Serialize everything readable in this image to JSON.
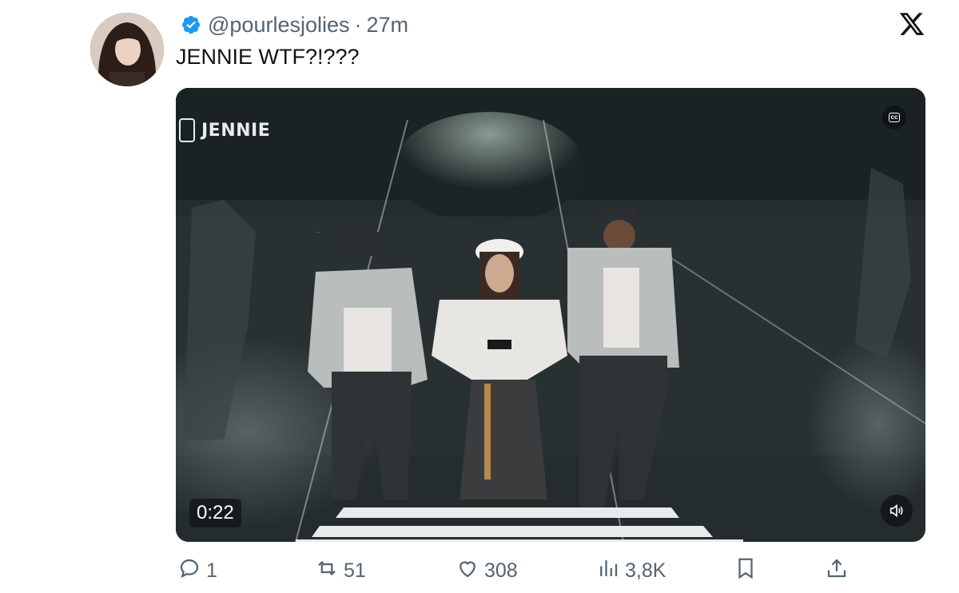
{
  "tweet": {
    "handle": "@pourlesjolies",
    "separator": "·",
    "time": "27m",
    "text": "JENNIE WTF?!???"
  },
  "video": {
    "channel_label": "JENNIE",
    "cc_label": "cc",
    "duration": "0:22"
  },
  "actions": {
    "replies": "1",
    "reposts": "51",
    "likes": "308",
    "views": "3,8K"
  },
  "icons": {
    "verified": "verified-badge-icon",
    "x_logo": "x-logo-icon",
    "reply": "reply-icon",
    "repost": "repost-icon",
    "like": "heart-icon",
    "views": "views-icon",
    "bookmark": "bookmark-icon",
    "share": "share-icon",
    "sound": "speaker-icon"
  },
  "colors": {
    "accent": "#1d9bf0",
    "muted": "#536471",
    "text": "#0f1419"
  }
}
